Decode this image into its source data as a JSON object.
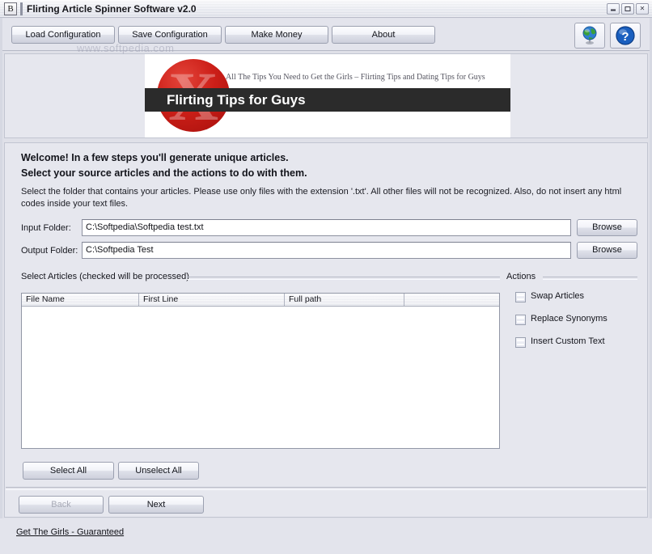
{
  "window": {
    "title": "Flirting Article Spinner Software v2.0",
    "app_icon": "B",
    "controls": {
      "minimize": "minimize-icon",
      "maximize": "maximize-icon",
      "close": "✕"
    }
  },
  "watermark": "www.softpedia.com",
  "toolbar": {
    "buttons": [
      {
        "label": "Load Configuration"
      },
      {
        "label": "Save Configuration"
      },
      {
        "label": "Make Money"
      },
      {
        "label": "About"
      }
    ],
    "icons": [
      {
        "name": "globe-icon"
      },
      {
        "name": "help-icon",
        "glyph": "?"
      }
    ]
  },
  "banner": {
    "tagline": "All The Tips You Need to Get the Girls – Flirting Tips and Dating Tips for Guys",
    "logo_letter": "X",
    "headline": "Flirting Tips for Guys"
  },
  "main": {
    "heading_line1": "Welcome! In a few steps you'll generate unique articles.",
    "heading_line2": "Select your source articles and the actions to do with them.",
    "description": "Select the folder that contains your articles. Please use only files with the extension '.txt'. All other files will not be recognized. Also, do not insert any html codes inside your text files.",
    "input_folder": {
      "label": "Input Folder:",
      "value": "C:\\Softpedia\\Softpedia test.txt",
      "browse_label": "Browse"
    },
    "output_folder": {
      "label": "Output Folder:",
      "value": "C:\\Softpedia Test",
      "browse_label": "Browse"
    },
    "articles_group_label": "Select Articles (checked will be processed)",
    "table": {
      "columns": [
        "File Name",
        "First Line",
        "Full path",
        ""
      ],
      "rows": []
    },
    "select_all_label": "Select All",
    "unselect_all_label": "Unselect All",
    "actions": {
      "group_label": "Actions",
      "items": [
        {
          "label": "Swap Articles",
          "checked": false
        },
        {
          "label": "Replace Synonyms",
          "checked": false
        },
        {
          "label": "Insert Custom Text",
          "checked": false
        }
      ]
    },
    "back_label": "Back",
    "next_label": "Next"
  },
  "footer": {
    "link_label": "Get The Girls - Guaranteed"
  }
}
